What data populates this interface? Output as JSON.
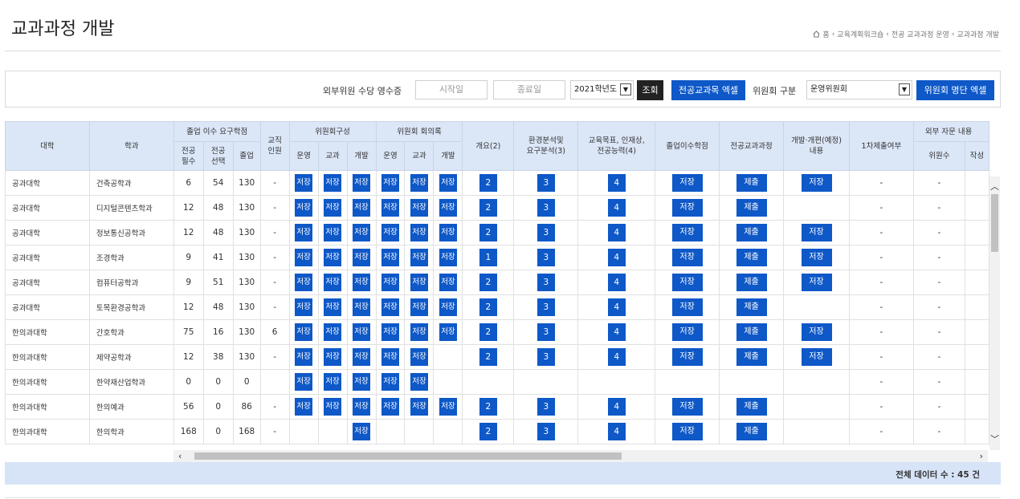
{
  "page": {
    "title": "교과과정 개발",
    "breadcrumb": [
      "홈",
      "교육계획워크숍",
      "전공 교과과정 운영",
      "교과과정 개발"
    ]
  },
  "filters": {
    "receipt_label": "외부위원 수당 영수증",
    "start_placeholder": "시작일",
    "end_placeholder": "종료일",
    "year_value": "2021학년도",
    "search_button": "조회",
    "excel_button": "전공교과목 엑셀",
    "committee_label": "위원회 구분",
    "committee_value": "운영위원회",
    "list_excel_button": "위원회 명단 엑셀"
  },
  "table": {
    "headers": {
      "college": "대학",
      "dept": "학과",
      "credits_group": "졸업 이수 요구학점",
      "major_req": "전공\n필수",
      "major_elec": "전공\n선택",
      "grad": "졸업",
      "teaching": "교직\n인원",
      "committee_comp": "위원회구성",
      "meeting_log": "위원회 회의록",
      "sub_ops": "운영",
      "sub_course": "교과",
      "sub_dev": "개발",
      "overview": "개요(2)",
      "env_analysis": "환경분석및\n요구분석(3)",
      "edu_goal": "교육목표, 인재상,\n전공능력(4)",
      "grad_credit": "졸업이수학점",
      "major_curr": "전공교과과정",
      "dev_revision": "개발·개편(예정)\n내용",
      "first_submit": "1차제출여부",
      "ext_advice": "외부 자문 내용",
      "members": "위원수",
      "writer": "작성"
    },
    "labels": {
      "save": "저장",
      "submit": "제출",
      "dash": "-",
      "n2": "2",
      "n1": "1",
      "n3": "3",
      "n4": "4"
    },
    "rows": [
      {
        "college": "공과대학",
        "dept": "건축공학과",
        "req": "6",
        "elec": "54",
        "grad": "130",
        "teach": "-",
        "comp": [
          1,
          1,
          1
        ],
        "meet": [
          1,
          1,
          1
        ],
        "ov": "2",
        "env": "3",
        "goal": "4",
        "gc": 1,
        "curr": 1,
        "dev": 1,
        "first": "-",
        "mem": "-"
      },
      {
        "college": "공과대학",
        "dept": "디지털콘텐츠학과",
        "req": "12",
        "elec": "48",
        "grad": "130",
        "teach": "-",
        "comp": [
          1,
          1,
          1
        ],
        "meet": [
          1,
          1,
          1
        ],
        "ov": "2",
        "env": "3",
        "goal": "4",
        "gc": 1,
        "curr": 1,
        "dev": 0,
        "first": "-",
        "mem": "-"
      },
      {
        "college": "공과대학",
        "dept": "정보통신공학과",
        "req": "12",
        "elec": "48",
        "grad": "130",
        "teach": "-",
        "comp": [
          1,
          1,
          1
        ],
        "meet": [
          1,
          1,
          1
        ],
        "ov": "2",
        "env": "3",
        "goal": "4",
        "gc": 1,
        "curr": 1,
        "dev": 1,
        "first": "-",
        "mem": "-"
      },
      {
        "college": "공과대학",
        "dept": "조경학과",
        "req": "9",
        "elec": "41",
        "grad": "130",
        "teach": "-",
        "comp": [
          1,
          1,
          1
        ],
        "meet": [
          1,
          1,
          1
        ],
        "ov": "1",
        "env": "3",
        "goal": "4",
        "gc": 1,
        "curr": 1,
        "dev": 1,
        "first": "-",
        "mem": "-"
      },
      {
        "college": "공과대학",
        "dept": "컴퓨터공학과",
        "req": "9",
        "elec": "51",
        "grad": "130",
        "teach": "-",
        "comp": [
          1,
          1,
          1
        ],
        "meet": [
          1,
          1,
          1
        ],
        "ov": "2",
        "env": "3",
        "goal": "4",
        "gc": 1,
        "curr": 1,
        "dev": 1,
        "first": "-",
        "mem": "-"
      },
      {
        "college": "공과대학",
        "dept": "토목환경공학과",
        "req": "12",
        "elec": "48",
        "grad": "130",
        "teach": "-",
        "comp": [
          1,
          1,
          1
        ],
        "meet": [
          1,
          1,
          1
        ],
        "ov": "2",
        "env": "3",
        "goal": "4",
        "gc": 1,
        "curr": 1,
        "dev": 0,
        "first": "-",
        "mem": "-"
      },
      {
        "college": "한의과대학",
        "dept": "간호학과",
        "req": "75",
        "elec": "16",
        "grad": "130",
        "teach": "6",
        "comp": [
          1,
          1,
          1
        ],
        "meet": [
          1,
          1,
          1
        ],
        "ov": "2",
        "env": "3",
        "goal": "4",
        "gc": 1,
        "curr": 1,
        "dev": 1,
        "first": "-",
        "mem": "-"
      },
      {
        "college": "한의과대학",
        "dept": "제약공학과",
        "req": "12",
        "elec": "38",
        "grad": "130",
        "teach": "-",
        "comp": [
          1,
          1,
          1
        ],
        "meet": [
          1,
          1,
          0
        ],
        "ov": "2",
        "env": "3",
        "goal": "4",
        "gc": 1,
        "curr": 1,
        "dev": 1,
        "first": "-",
        "mem": "-"
      },
      {
        "college": "한의과대학",
        "dept": "한약재산업학과",
        "req": "0",
        "elec": "0",
        "grad": "0",
        "teach": "",
        "comp": [
          1,
          1,
          1
        ],
        "meet": [
          1,
          1,
          0
        ],
        "ov": "",
        "env": "",
        "goal": "",
        "gc": 0,
        "curr": 0,
        "dev": 0,
        "first": "-",
        "mem": "-"
      },
      {
        "college": "한의과대학",
        "dept": "한의예과",
        "req": "56",
        "elec": "0",
        "grad": "86",
        "teach": "-",
        "comp": [
          1,
          1,
          1
        ],
        "meet": [
          1,
          1,
          1
        ],
        "ov": "2",
        "env": "3",
        "goal": "4",
        "gc": 1,
        "curr": 1,
        "dev": 0,
        "first": "-",
        "mem": "-"
      },
      {
        "college": "한의과대학",
        "dept": "한의학과",
        "req": "168",
        "elec": "0",
        "grad": "168",
        "teach": "-",
        "comp": [
          0,
          0,
          1
        ],
        "meet": [
          0,
          0,
          0
        ],
        "ov": "2",
        "env": "3",
        "goal": "4",
        "gc": 1,
        "curr": 1,
        "dev": 0,
        "first": "-",
        "mem": "-"
      }
    ]
  },
  "footer": {
    "total_label": "전체 데이터 수 : 45 건"
  },
  "colors": {
    "accent": "#0e58c8",
    "header_bg": "#dbe6f7",
    "footer_bg": "#d7e4f7"
  }
}
